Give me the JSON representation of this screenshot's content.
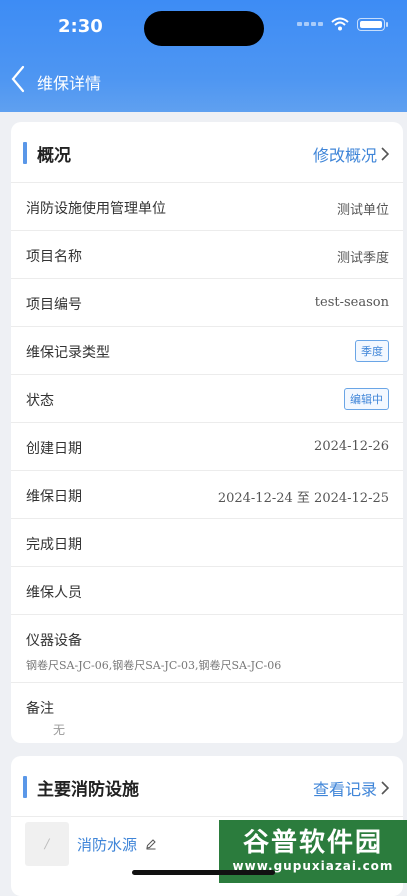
{
  "status_bar": {
    "time": "2:30"
  },
  "nav": {
    "title": "维保详情"
  },
  "overview": {
    "title": "概况",
    "action_label": "修改概况",
    "rows": [
      {
        "label": "消防设施使用管理单位",
        "value": "测试单位"
      },
      {
        "label": "项目名称",
        "value": "测试季度"
      },
      {
        "label": "项目编号",
        "value": "test-season"
      },
      {
        "label": "维保记录类型",
        "tag": "季度"
      },
      {
        "label": "状态",
        "tag": "编辑中"
      },
      {
        "label": "创建日期",
        "value": "2024-12-26"
      },
      {
        "label": "维保日期",
        "value": "2024-12-24 至 2024-12-25"
      },
      {
        "label": "完成日期"
      },
      {
        "label": "维保人员"
      },
      {
        "label": "仪器设备",
        "detail": "钢卷尺SA-JC-06,钢卷尺SA-JC-03,钢卷尺SA-JC-06"
      },
      {
        "label": "备注",
        "detail": "无"
      }
    ]
  },
  "facilities": {
    "title": "主要消防设施",
    "action_label": "查看记录",
    "items": [
      {
        "thumb_text": "/",
        "name": "消防水源"
      }
    ]
  },
  "watermark": {
    "line1": "谷普软件园",
    "line2": "www.gupuxiazai.com"
  },
  "colors": {
    "header": "#3d8cf5",
    "accent": "#3f85d8",
    "background": "#eef0f4"
  }
}
